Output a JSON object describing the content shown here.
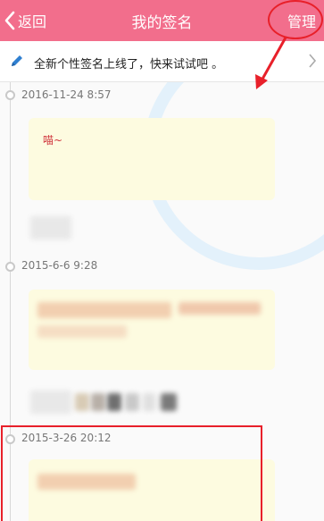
{
  "header": {
    "back_label": "返回",
    "title": "我的签名",
    "manage_label": "管理"
  },
  "notice": {
    "text": "全新个性签名上线了，快来试试吧 。",
    "icon": "pencil-icon"
  },
  "entries": [
    {
      "date": "2016-11-24 8:57",
      "text": "喵~"
    },
    {
      "date": "2015-6-6 9:28"
    },
    {
      "date": "2015-3-26 20:12"
    }
  ],
  "colors": {
    "header_bg": "#f26e8c",
    "card_bg": "#fdfbe0",
    "annotation": "#e8202a"
  }
}
